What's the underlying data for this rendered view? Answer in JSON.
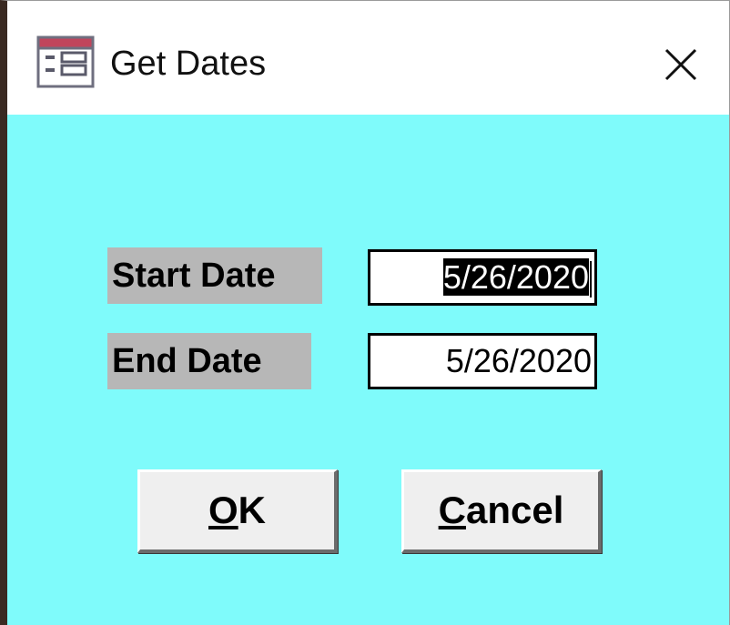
{
  "window": {
    "title": "Get Dates",
    "icon": "form-icon",
    "close_icon": "close-icon"
  },
  "form": {
    "start_date": {
      "label": "Start Date",
      "value": "5/26/2020",
      "selected": true
    },
    "end_date": {
      "label": "End Date",
      "value": "5/26/2020"
    }
  },
  "buttons": {
    "ok": {
      "accelerator": "O",
      "rest": "K"
    },
    "cancel": {
      "accelerator": "C",
      "rest": "ancel"
    }
  },
  "colors": {
    "form_background": "#7ffbfb",
    "label_background": "#b7b7b7",
    "button_face": "#efefef",
    "titlebar": "#ffffff"
  }
}
